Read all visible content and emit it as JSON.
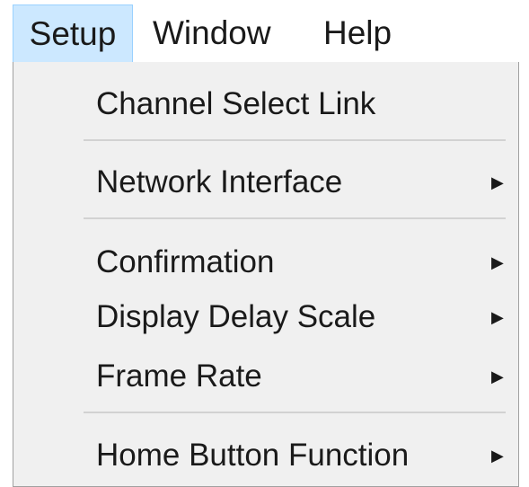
{
  "menubar": {
    "items": [
      {
        "label": "Setup",
        "active": true
      },
      {
        "label": "Window",
        "active": false
      },
      {
        "label": "Help",
        "active": false
      }
    ]
  },
  "dropdown": {
    "items": [
      {
        "label": "Channel Select Link",
        "submenu": false
      },
      {
        "label": "Network Interface",
        "submenu": true
      },
      {
        "label": "Confirmation",
        "submenu": true
      },
      {
        "label": "Display Delay Scale",
        "submenu": true
      },
      {
        "label": "Frame Rate",
        "submenu": true
      },
      {
        "label": "Home Button Function",
        "submenu": true
      }
    ]
  },
  "colors": {
    "menubar_active_bg": "#cce8ff",
    "menubar_active_border": "#99d1ff",
    "dropdown_bg": "#f0f0f0",
    "dropdown_border": "#a0a0a0",
    "separator": "#d2d2d2"
  },
  "icons": {
    "submenu_arrow": "triangle-right-icon"
  }
}
